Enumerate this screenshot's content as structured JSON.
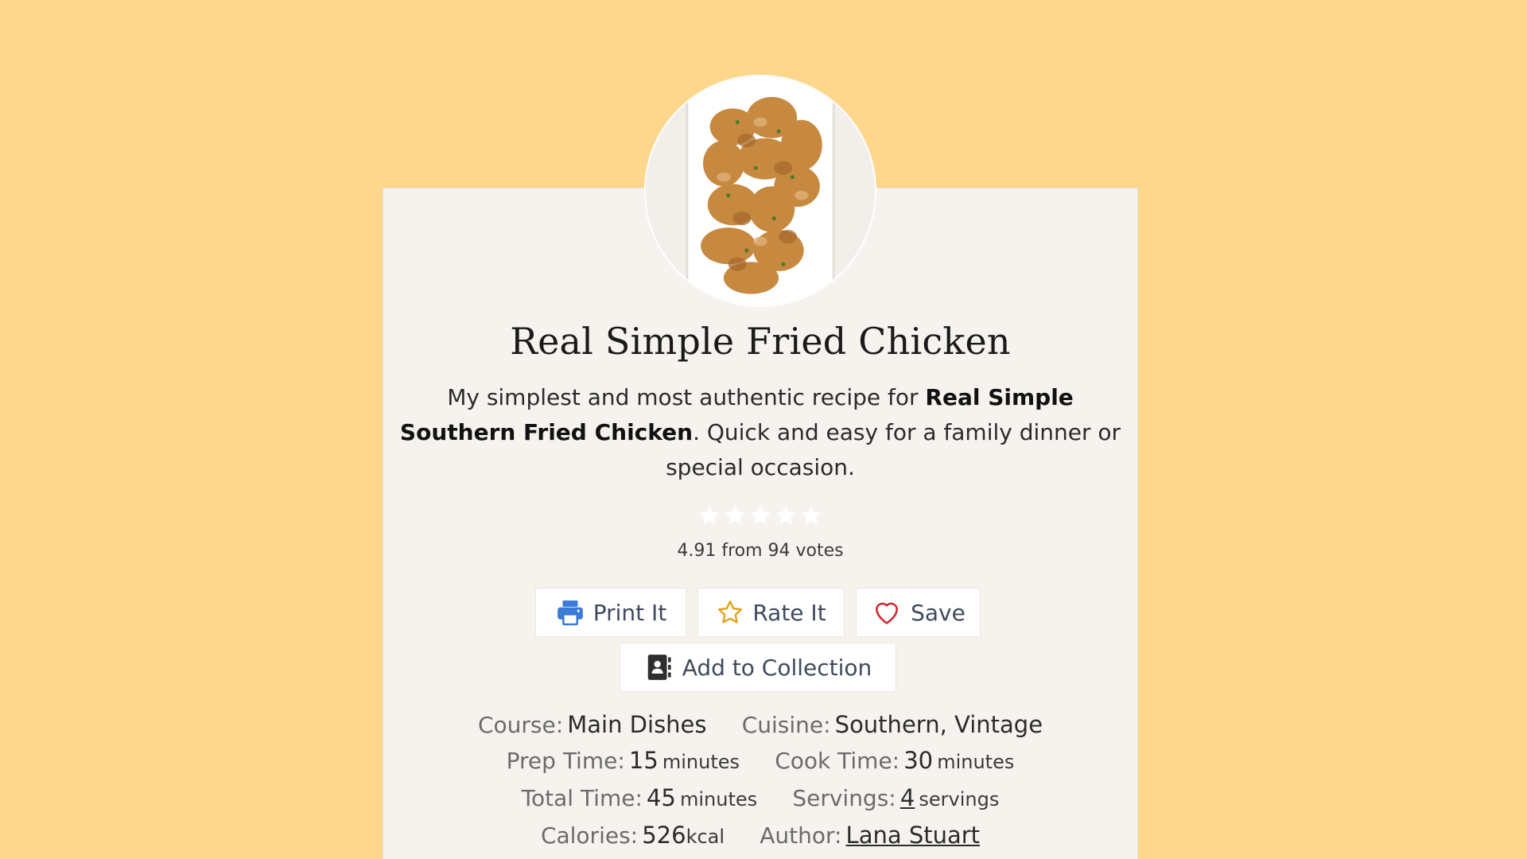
{
  "recipe": {
    "title": "Real Simple Fried Chicken",
    "summary": {
      "part1": "My simplest and most authentic recipe for ",
      "bold": "Real Simple Southern Fried Chicken",
      "part2": ". Quick and easy for a family dinner or special occasion."
    },
    "rating": {
      "stars": 5,
      "votes_text": "4.91 from 94 votes"
    }
  },
  "buttons": {
    "print": "Print It",
    "rate": "Rate It",
    "save": "Save",
    "collection": "Add to Collection"
  },
  "meta": {
    "course_label": "Course:",
    "course_value": "Main Dishes",
    "cuisine_label": "Cuisine:",
    "cuisine_value": "Southern, Vintage",
    "prep_label": "Prep Time:",
    "prep_value": "15",
    "prep_unit": "minutes",
    "cook_label": "Cook Time:",
    "cook_value": "30",
    "cook_unit": "minutes",
    "total_label": "Total Time:",
    "total_value": "45",
    "total_unit": "minutes",
    "servings_label": "Servings:",
    "servings_value": "4",
    "servings_unit": "servings",
    "calories_label": "Calories:",
    "calories_value": "526",
    "calories_unit": "kcal",
    "author_label": "Author:",
    "author_value": "Lana Stuart"
  },
  "colors": {
    "background": "#fed68c",
    "card": "#f6f3ef",
    "print_icon": "#3b7ad6",
    "rate_icon": "#e0a31e",
    "save_icon": "#d0242f",
    "link": "#3b7ad6"
  },
  "icons": {
    "print": "printer-icon",
    "rate": "star-outline-icon",
    "save": "heart-outline-icon",
    "collection": "contact-book-icon",
    "rating_star": "star-filled-icon"
  }
}
